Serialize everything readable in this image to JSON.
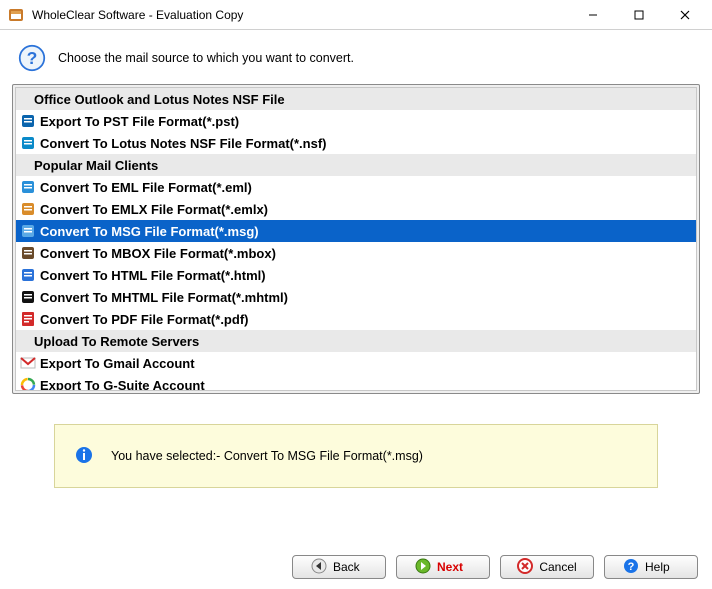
{
  "window": {
    "title": "WholeClear Software - Evaluation Copy"
  },
  "instruction": "Choose the mail source to which you want to convert.",
  "list": {
    "rows": [
      {
        "type": "header",
        "label": "Office Outlook and Lotus Notes NSF File"
      },
      {
        "type": "item",
        "icon": "outlook-icon",
        "color": "#0a64ad",
        "label": "Export To PST File Format(*.pst)"
      },
      {
        "type": "item",
        "icon": "lotus-icon",
        "color": "#0a8ac9",
        "label": "Convert To Lotus Notes NSF File Format(*.nsf)"
      },
      {
        "type": "header",
        "label": "Popular Mail Clients"
      },
      {
        "type": "item",
        "icon": "eml-icon",
        "color": "#2a90d9",
        "label": "Convert To EML File Format(*.eml)"
      },
      {
        "type": "item",
        "icon": "emlx-icon",
        "color": "#d98c2a",
        "label": "Convert To EMLX File Format(*.emlx)"
      },
      {
        "type": "item",
        "icon": "msg-icon",
        "color": "#5aa9e6",
        "label": "Convert To MSG File Format(*.msg)",
        "selected": true
      },
      {
        "type": "item",
        "icon": "mbox-icon",
        "color": "#6a4a2a",
        "label": "Convert To MBOX File Format(*.mbox)"
      },
      {
        "type": "item",
        "icon": "html-icon",
        "color": "#2a72d9",
        "label": "Convert To HTML File Format(*.html)"
      },
      {
        "type": "item",
        "icon": "mhtml-icon",
        "color": "#111111",
        "label": "Convert To MHTML File Format(*.mhtml)"
      },
      {
        "type": "item",
        "icon": "pdf-icon",
        "color": "#d32a2a",
        "label": "Convert To PDF File Format(*.pdf)"
      },
      {
        "type": "header",
        "label": "Upload To Remote Servers"
      },
      {
        "type": "item",
        "icon": "gmail-icon",
        "color": "#d32a2a",
        "label": "Export To Gmail Account"
      },
      {
        "type": "item",
        "icon": "gsuite-icon",
        "color": "#1a73e8",
        "label": "Export To G-Suite Account"
      }
    ]
  },
  "status": {
    "prefix": "You have selected:- ",
    "value": "Convert To MSG File Format(*.msg)"
  },
  "buttons": {
    "back": "Back",
    "next": "Next",
    "cancel": "Cancel",
    "help": "Help"
  }
}
